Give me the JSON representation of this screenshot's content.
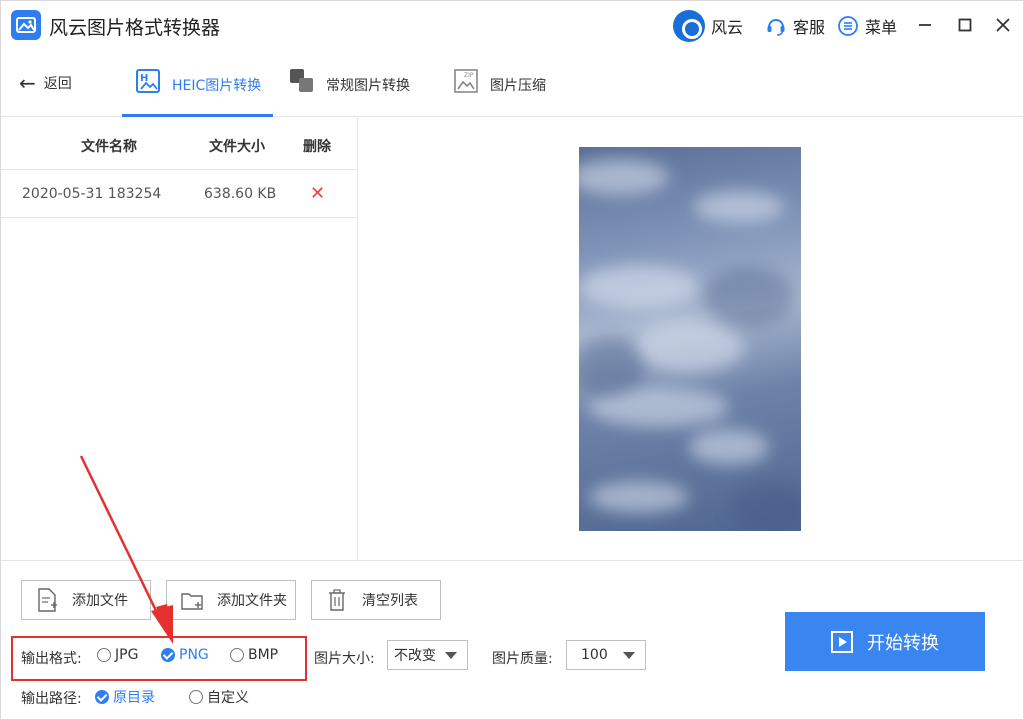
{
  "app": {
    "title": "风云图片格式转换器",
    "brand_label": "风云",
    "service_label": "客服",
    "menu_label": "菜单"
  },
  "nav": {
    "back_label": "返回",
    "tabs": [
      {
        "label": "HEIC图片转换",
        "active": true
      },
      {
        "label": "常规图片转换",
        "active": false
      },
      {
        "label": "图片压缩",
        "active": false
      }
    ]
  },
  "file_list": {
    "headers": {
      "name": "文件名称",
      "size": "文件大小",
      "delete": "删除"
    },
    "rows": [
      {
        "name": "2020-05-31 183254",
        "size": "638.60 KB"
      }
    ]
  },
  "buttons": {
    "add_file": "添加文件",
    "add_folder": "添加文件夹",
    "clear_list": "清空列表",
    "start": "开始转换"
  },
  "output": {
    "format_label": "输出格式:",
    "formats": [
      {
        "label": "JPG",
        "selected": false
      },
      {
        "label": "PNG",
        "selected": true
      },
      {
        "label": "BMP",
        "selected": false
      }
    ],
    "size_label": "图片大小:",
    "size_value": "不改变",
    "quality_label": "图片质量:",
    "quality_value": "100",
    "path_label": "输出路径:",
    "paths": [
      {
        "label": "原目录",
        "selected": true
      },
      {
        "label": "自定义",
        "selected": false
      }
    ]
  },
  "colors": {
    "accent": "#2f7df0",
    "danger": "#e64545",
    "annotation": "#e53030"
  }
}
